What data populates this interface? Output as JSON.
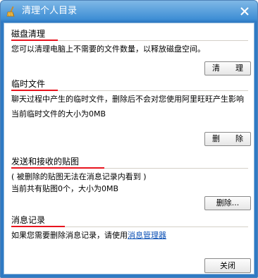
{
  "window": {
    "title": "清理个人目录",
    "icon": "broom-icon",
    "close_icon": "close-icon"
  },
  "sections": [
    {
      "title": "磁盘清理",
      "desc": "您可以清理电脑上不需要的文件数量，以释放磁盘空间。",
      "button": "清　理"
    },
    {
      "title": "临时文件",
      "desc": "聊天过程中产生的临时文件，删除后不会对您使用阿里旺旺产生影响",
      "size_text": "当前临时文件的大小为0MB",
      "button": "删　除"
    },
    {
      "title": "发送和接收的贴图",
      "note": "( 被删除的贴图无法在消息记录内看到 )",
      "count_text": "当前共有贴图0个，大小为0MB",
      "button": "删除..."
    },
    {
      "title": "消息记录",
      "desc_prefix": "如果您需要删除消息记录，请使用",
      "link": "消息管理器"
    }
  ],
  "footer": {
    "close_button": "关闭"
  },
  "colors": {
    "accent_underline": "#e8141e",
    "link": "#0a4fb4",
    "titlebar": "#3f8fd5"
  }
}
